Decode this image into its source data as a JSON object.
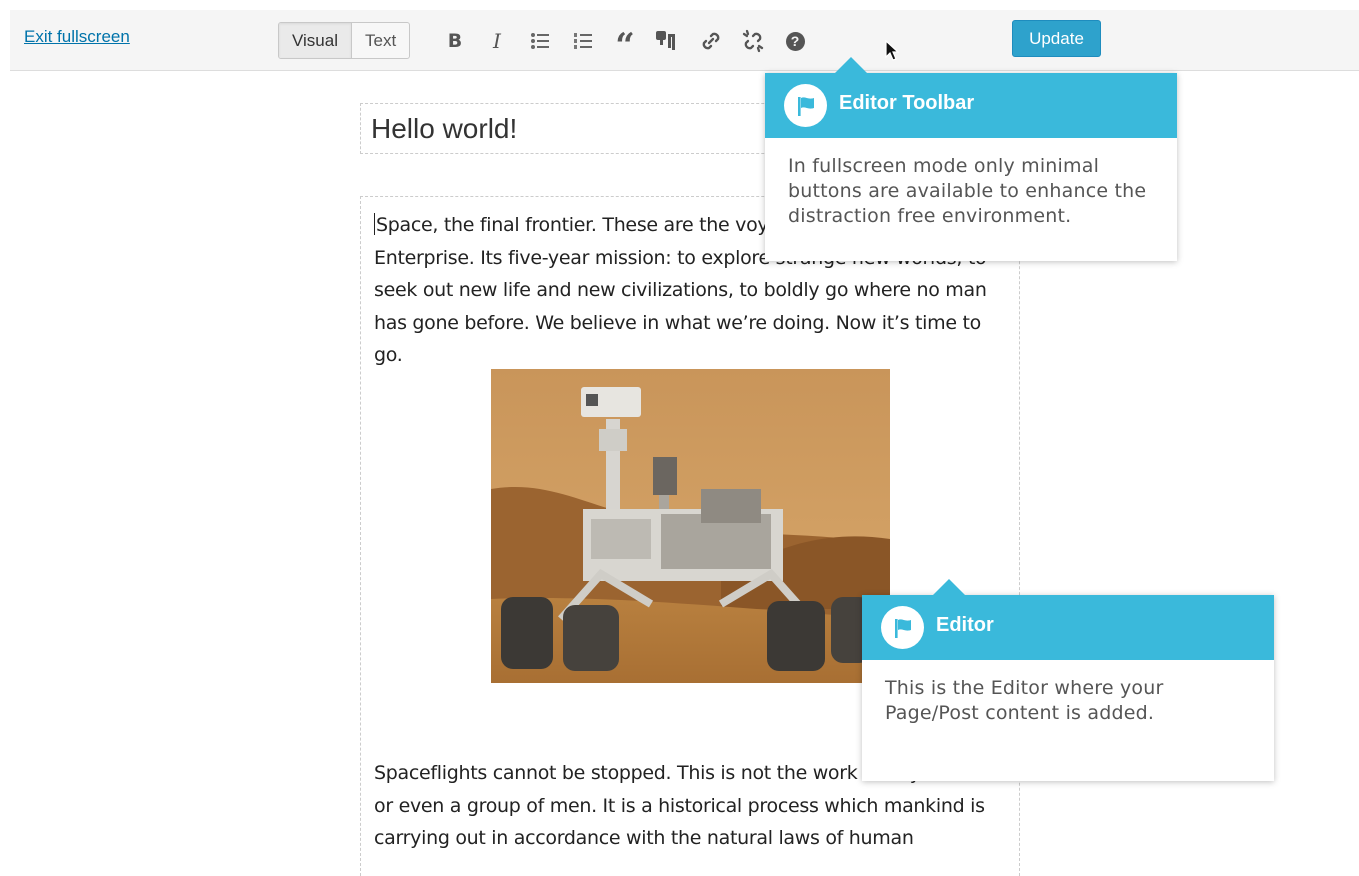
{
  "toolbar": {
    "exit_label": "Exit fullscreen",
    "visual_label": "Visual",
    "text_label": "Text",
    "bold_label": "B",
    "italic_label": "I",
    "quote_label": "“",
    "help_label": "?",
    "update_label": "Update"
  },
  "icons": [
    "bold-icon",
    "italic-icon",
    "bullet-list-icon",
    "numbered-list-icon",
    "blockquote-icon",
    "paragraph-icon",
    "link-icon",
    "unlink-icon",
    "help-icon",
    "flag-icon",
    "cursor-icon"
  ],
  "post": {
    "title": "Hello world!",
    "paragraph1_lines": [
      "Space, the final frontier. These are the voyages of the Starship",
      "Enterprise. Its five-year mission: to explore strange new worlds, to",
      "seek out new life and new civilizations, to boldly go where no man",
      "has gone before. We believe in what we’re doing. Now it’s time to go."
    ],
    "paragraph2_lines": [
      "Spaceflights cannot be stopped. This is not the work of any one man",
      "or even a group of men. It is a historical process which mankind is",
      "carrying out in accordance with the natural laws of human"
    ]
  },
  "tooltips": {
    "toolbar": {
      "title": "Editor Toolbar",
      "body": "In fullscreen mode only minimal buttons are available to enhance the distraction free environment."
    },
    "editor": {
      "title": "Editor",
      "body": "This is the Editor where your Page/Post content is added."
    }
  },
  "colors": {
    "accent": "#3ab9db",
    "update_button": "#2ea2cc",
    "link": "#0073aa"
  }
}
